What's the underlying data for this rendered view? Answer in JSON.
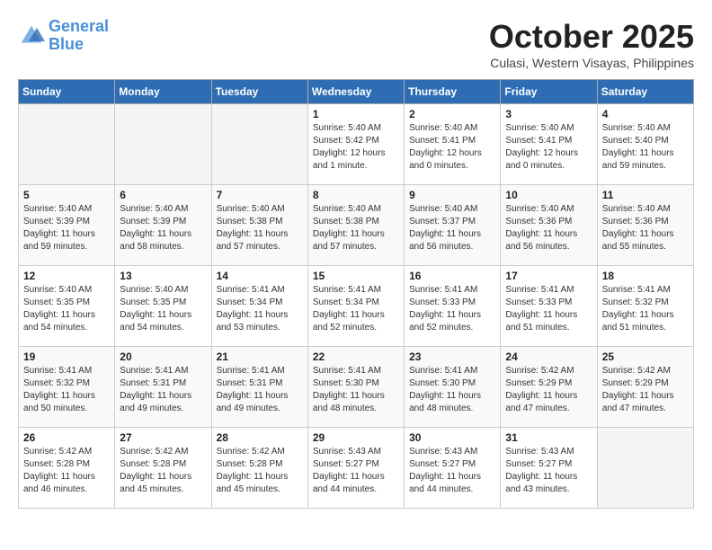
{
  "header": {
    "logo_line1": "General",
    "logo_line2": "Blue",
    "month_title": "October 2025",
    "location": "Culasi, Western Visayas, Philippines"
  },
  "weekdays": [
    "Sunday",
    "Monday",
    "Tuesday",
    "Wednesday",
    "Thursday",
    "Friday",
    "Saturday"
  ],
  "weeks": [
    [
      {
        "day": "",
        "info": ""
      },
      {
        "day": "",
        "info": ""
      },
      {
        "day": "",
        "info": ""
      },
      {
        "day": "1",
        "info": "Sunrise: 5:40 AM\nSunset: 5:42 PM\nDaylight: 12 hours\nand 1 minute."
      },
      {
        "day": "2",
        "info": "Sunrise: 5:40 AM\nSunset: 5:41 PM\nDaylight: 12 hours\nand 0 minutes."
      },
      {
        "day": "3",
        "info": "Sunrise: 5:40 AM\nSunset: 5:41 PM\nDaylight: 12 hours\nand 0 minutes."
      },
      {
        "day": "4",
        "info": "Sunrise: 5:40 AM\nSunset: 5:40 PM\nDaylight: 11 hours\nand 59 minutes."
      }
    ],
    [
      {
        "day": "5",
        "info": "Sunrise: 5:40 AM\nSunset: 5:39 PM\nDaylight: 11 hours\nand 59 minutes."
      },
      {
        "day": "6",
        "info": "Sunrise: 5:40 AM\nSunset: 5:39 PM\nDaylight: 11 hours\nand 58 minutes."
      },
      {
        "day": "7",
        "info": "Sunrise: 5:40 AM\nSunset: 5:38 PM\nDaylight: 11 hours\nand 57 minutes."
      },
      {
        "day": "8",
        "info": "Sunrise: 5:40 AM\nSunset: 5:38 PM\nDaylight: 11 hours\nand 57 minutes."
      },
      {
        "day": "9",
        "info": "Sunrise: 5:40 AM\nSunset: 5:37 PM\nDaylight: 11 hours\nand 56 minutes."
      },
      {
        "day": "10",
        "info": "Sunrise: 5:40 AM\nSunset: 5:36 PM\nDaylight: 11 hours\nand 56 minutes."
      },
      {
        "day": "11",
        "info": "Sunrise: 5:40 AM\nSunset: 5:36 PM\nDaylight: 11 hours\nand 55 minutes."
      }
    ],
    [
      {
        "day": "12",
        "info": "Sunrise: 5:40 AM\nSunset: 5:35 PM\nDaylight: 11 hours\nand 54 minutes."
      },
      {
        "day": "13",
        "info": "Sunrise: 5:40 AM\nSunset: 5:35 PM\nDaylight: 11 hours\nand 54 minutes."
      },
      {
        "day": "14",
        "info": "Sunrise: 5:41 AM\nSunset: 5:34 PM\nDaylight: 11 hours\nand 53 minutes."
      },
      {
        "day": "15",
        "info": "Sunrise: 5:41 AM\nSunset: 5:34 PM\nDaylight: 11 hours\nand 52 minutes."
      },
      {
        "day": "16",
        "info": "Sunrise: 5:41 AM\nSunset: 5:33 PM\nDaylight: 11 hours\nand 52 minutes."
      },
      {
        "day": "17",
        "info": "Sunrise: 5:41 AM\nSunset: 5:33 PM\nDaylight: 11 hours\nand 51 minutes."
      },
      {
        "day": "18",
        "info": "Sunrise: 5:41 AM\nSunset: 5:32 PM\nDaylight: 11 hours\nand 51 minutes."
      }
    ],
    [
      {
        "day": "19",
        "info": "Sunrise: 5:41 AM\nSunset: 5:32 PM\nDaylight: 11 hours\nand 50 minutes."
      },
      {
        "day": "20",
        "info": "Sunrise: 5:41 AM\nSunset: 5:31 PM\nDaylight: 11 hours\nand 49 minutes."
      },
      {
        "day": "21",
        "info": "Sunrise: 5:41 AM\nSunset: 5:31 PM\nDaylight: 11 hours\nand 49 minutes."
      },
      {
        "day": "22",
        "info": "Sunrise: 5:41 AM\nSunset: 5:30 PM\nDaylight: 11 hours\nand 48 minutes."
      },
      {
        "day": "23",
        "info": "Sunrise: 5:41 AM\nSunset: 5:30 PM\nDaylight: 11 hours\nand 48 minutes."
      },
      {
        "day": "24",
        "info": "Sunrise: 5:42 AM\nSunset: 5:29 PM\nDaylight: 11 hours\nand 47 minutes."
      },
      {
        "day": "25",
        "info": "Sunrise: 5:42 AM\nSunset: 5:29 PM\nDaylight: 11 hours\nand 47 minutes."
      }
    ],
    [
      {
        "day": "26",
        "info": "Sunrise: 5:42 AM\nSunset: 5:28 PM\nDaylight: 11 hours\nand 46 minutes."
      },
      {
        "day": "27",
        "info": "Sunrise: 5:42 AM\nSunset: 5:28 PM\nDaylight: 11 hours\nand 45 minutes."
      },
      {
        "day": "28",
        "info": "Sunrise: 5:42 AM\nSunset: 5:28 PM\nDaylight: 11 hours\nand 45 minutes."
      },
      {
        "day": "29",
        "info": "Sunrise: 5:43 AM\nSunset: 5:27 PM\nDaylight: 11 hours\nand 44 minutes."
      },
      {
        "day": "30",
        "info": "Sunrise: 5:43 AM\nSunset: 5:27 PM\nDaylight: 11 hours\nand 44 minutes."
      },
      {
        "day": "31",
        "info": "Sunrise: 5:43 AM\nSunset: 5:27 PM\nDaylight: 11 hours\nand 43 minutes."
      },
      {
        "day": "",
        "info": ""
      }
    ]
  ]
}
